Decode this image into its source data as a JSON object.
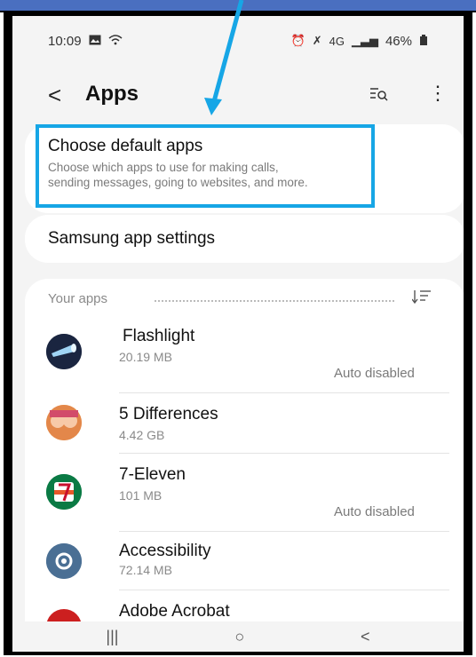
{
  "status_bar": {
    "time": "10:09",
    "left_icons": [
      "image-icon",
      "wifi-icon"
    ],
    "right_icons": [
      "alarm-icon",
      "mute-icon",
      "4g-lte-icon",
      "signal-icon"
    ],
    "battery": "46%"
  },
  "header": {
    "back_label": "<",
    "title": "Apps",
    "more_label": "⋮"
  },
  "default_apps": {
    "title": "Choose default apps",
    "subtitle_line1": "Choose which apps to use for making calls,",
    "subtitle_line2": "sending messages, going to websites, and more."
  },
  "samsung_settings": {
    "title": "Samsung app settings"
  },
  "your_apps": {
    "label": "Your apps",
    "apps": [
      {
        "name": "Flashlight",
        "size": "20.19 MB",
        "status": "Auto disabled",
        "icon": "flashlight-icon"
      },
      {
        "name": "5 Differences",
        "size": "4.42 GB",
        "status": "",
        "icon": "5-differences-icon"
      },
      {
        "name": "7-Eleven",
        "size": "101 MB",
        "status": "Auto disabled",
        "icon": "7-eleven-icon"
      },
      {
        "name": "Accessibility",
        "size": "72.14 MB",
        "status": "",
        "icon": "accessibility-gear-icon"
      },
      {
        "name": "Adobe Acrobat",
        "size": "",
        "status": "",
        "icon": "adobe-acrobat-icon"
      }
    ]
  },
  "nav_bar": {
    "recents": "|||",
    "home": "○",
    "back": "<"
  },
  "colors": {
    "highlight": "#16a6e6",
    "background": "#f4f4f4"
  }
}
